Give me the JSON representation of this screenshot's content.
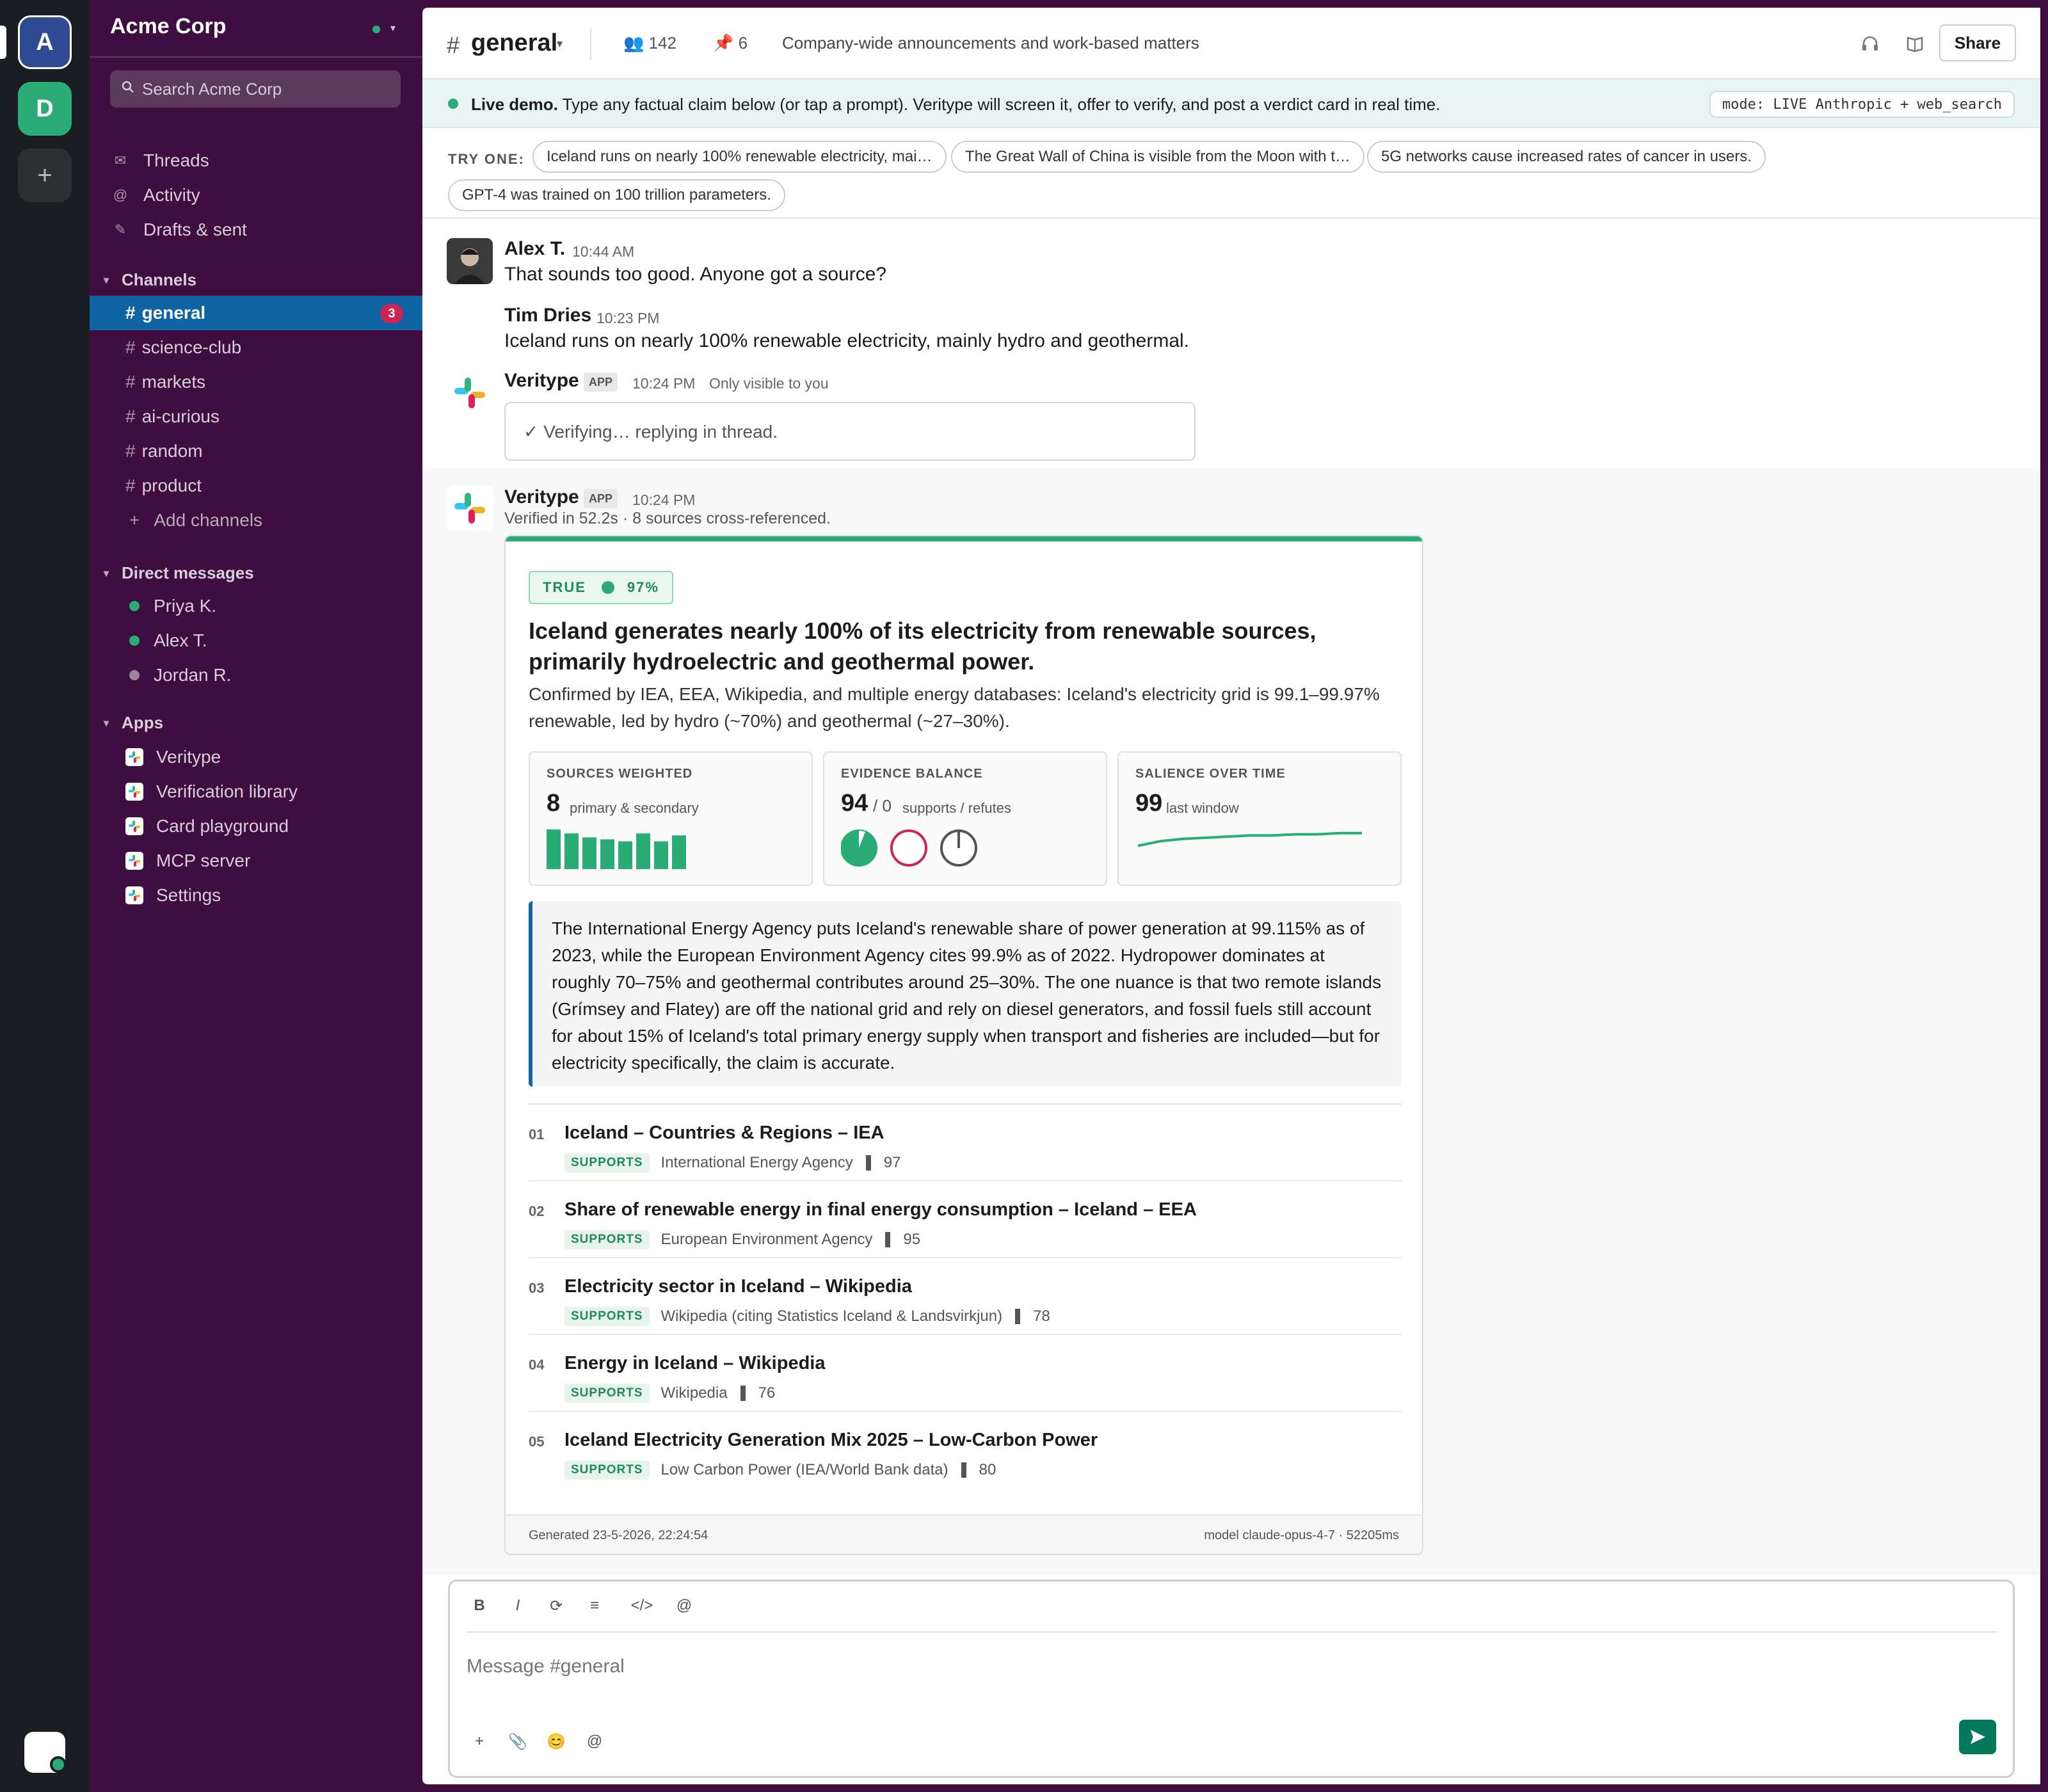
{
  "workspace": {
    "initials_a": "A",
    "initials_d": "D",
    "add_icon": "+",
    "name": "Acme Corp"
  },
  "sidebar": {
    "search_placeholder": "Search Acme Corp",
    "nav": [
      {
        "label": "Threads",
        "icon": "threads-icon"
      },
      {
        "label": "Activity",
        "icon": "at-icon"
      },
      {
        "label": "Drafts & sent",
        "icon": "pencil-icon"
      }
    ],
    "channels_heading": "Channels",
    "channels": [
      {
        "name": "general",
        "badge": "3",
        "active": true
      },
      {
        "name": "science-club"
      },
      {
        "name": "markets"
      },
      {
        "name": "ai-curious"
      },
      {
        "name": "random"
      },
      {
        "name": "product"
      }
    ],
    "add_channels": "Add channels",
    "dm_heading": "Direct messages",
    "dms": [
      {
        "name": "Priya K.",
        "online": true
      },
      {
        "name": "Alex T.",
        "online": true
      },
      {
        "name": "Jordan R.",
        "online": false
      }
    ],
    "apps_heading": "Apps",
    "apps": [
      "Veritype",
      "Verification library",
      "Card playground",
      "MCP server",
      "Settings"
    ]
  },
  "header": {
    "channel": "general",
    "members": "142",
    "pins": "6",
    "topic": "Company-wide announcements and work-based matters",
    "share": "Share"
  },
  "banner": {
    "lead": "Live demo.",
    "text": "Type any factual claim below (or tap a prompt). Veritype will screen it, offer to verify, and post a verdict card in real time.",
    "mode": "mode: LIVE Anthropic + web_search"
  },
  "try_one": {
    "label": "TRY ONE:",
    "chips": [
      "Iceland runs on nearly 100% renewable electricity, mai…",
      "The Great Wall of China is visible from the Moon with t…",
      "5G networks cause increased rates of cancer in users.",
      "GPT-4 was trained on 100 trillion parameters."
    ]
  },
  "messages": [
    {
      "author": "Alex T.",
      "time": "10:44 AM",
      "text": "That sounds too good. Anyone got a source?"
    },
    {
      "author": "Tim Dries",
      "time": "10:23 PM",
      "text": "Iceland runs on nearly 100% renewable electricity, mainly hydro and geothermal."
    },
    {
      "author": "Veritype",
      "tag": "APP",
      "time": "10:24 PM",
      "note": "Only visible to you",
      "box": "✓ Verifying… replying in thread."
    },
    {
      "author": "Veritype",
      "tag": "APP",
      "time": "10:24 PM",
      "text": "Verified in 52.2s · 8 sources cross-referenced."
    }
  ],
  "card": {
    "verdict": "TRUE",
    "confidence": "97%",
    "claim": "Iceland generates nearly 100% of its electricity from renewable sources, primarily hydroelectric and geothermal power.",
    "summary": "Confirmed by IEA, EEA, Wikipedia, and multiple energy databases: Iceland's electricity grid is 99.1–99.97% renewable, led by hydro (~70%) and geothermal (~27–30%).",
    "stats": {
      "sources": {
        "label": "SOURCES WEIGHTED",
        "value": "8",
        "sub": "primary & secondary",
        "bar_values": [
          100,
          90,
          80,
          75,
          70,
          90,
          70,
          85
        ]
      },
      "balance": {
        "label": "EVIDENCE BALANCE",
        "value": "94",
        "secondary": "/ 0",
        "sub": "supports / refutes",
        "pie_fractions": [
          0.94,
          0.0,
          0.06
        ]
      },
      "salience": {
        "label": "SALIENCE OVER TIME",
        "value": "99",
        "sub": "last window",
        "series": [
          88,
          92,
          94,
          95,
          96,
          97,
          97,
          98,
          98,
          99,
          99
        ]
      }
    },
    "reasoning": "The International Energy Agency puts Iceland's renewable share of power generation at 99.115% as of 2023, while the European Environment Agency cites 99.9% as of 2022. Hydropower dominates at roughly 70–75% and geothermal contributes around 25–30%. The one nuance is that two remote islands (Grímsey and Flatey) are off the national grid and rely on diesel generators, and fossil fuels still account for about 15% of Iceland's total primary energy supply when transport and fisheries are included—but for electricity specifically, the claim is accurate.",
    "sources": [
      {
        "n": "01",
        "title": "Iceland – Countries & Regions – IEA",
        "stance": "SUPPORTS",
        "publisher": "International Energy Agency",
        "score": "97"
      },
      {
        "n": "02",
        "title": "Share of renewable energy in final energy consumption – Iceland – EEA",
        "stance": "SUPPORTS",
        "publisher": "European Environment Agency",
        "score": "95"
      },
      {
        "n": "03",
        "title": "Electricity sector in Iceland – Wikipedia",
        "stance": "SUPPORTS",
        "publisher": "Wikipedia (citing Statistics Iceland & Landsvirkjun)",
        "score": "78"
      },
      {
        "n": "04",
        "title": "Energy in Iceland – Wikipedia",
        "stance": "SUPPORTS",
        "publisher": "Wikipedia",
        "score": "76"
      },
      {
        "n": "05",
        "title": "Iceland Electricity Generation Mix 2025 – Low-Carbon Power",
        "stance": "SUPPORTS",
        "publisher": "Low Carbon Power (IEA/World Bank data)",
        "score": "80"
      }
    ],
    "generated": "Generated 23-5-2026, 22:24:54",
    "model": "model claude-opus-4-7 · 52205ms"
  },
  "composer": {
    "placeholder": "Message #general",
    "tools": [
      "B",
      "I",
      "⟳",
      "≡",
      "</>",
      "@"
    ],
    "actions": [
      "+",
      "📎",
      "😊",
      "@"
    ]
  },
  "colors": {
    "aubergine": "#3f0e40",
    "active": "#1164a3",
    "green": "#2bac76",
    "badge": "#cd2553"
  }
}
